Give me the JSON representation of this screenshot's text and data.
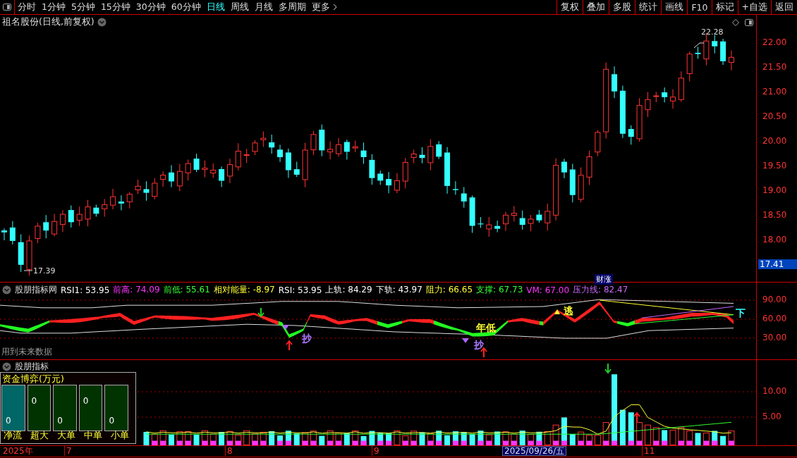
{
  "toolbar": {
    "periods": [
      {
        "label": "分时",
        "selected": false
      },
      {
        "label": "1分钟",
        "selected": false
      },
      {
        "label": "5分钟",
        "selected": false
      },
      {
        "label": "15分钟",
        "selected": false
      },
      {
        "label": "30分钟",
        "selected": false
      },
      {
        "label": "60分钟",
        "selected": false
      },
      {
        "label": "日线",
        "selected": true
      },
      {
        "label": "周线",
        "selected": false
      },
      {
        "label": "月线",
        "selected": false
      },
      {
        "label": "多周期",
        "selected": false
      }
    ],
    "more": "更多",
    "actions": [
      "复权",
      "叠加",
      "多股",
      "统计",
      "画线",
      "F10",
      "标记",
      "+自选",
      "返回"
    ]
  },
  "price_panel": {
    "title": "祖名股份(日线,前复权)",
    "y_ticks": [
      "22.00",
      "21.50",
      "21.00",
      "20.50",
      "20.00",
      "19.50",
      "19.00",
      "18.50",
      "18.00"
    ],
    "high_label": "22.28",
    "low_label": "17.39",
    "price_tag": "17.41",
    "event_tag": "财涨"
  },
  "indicator_panel": {
    "title": "股朋指标网",
    "readouts": [
      {
        "label": "RSI1:",
        "value": "53.95",
        "color": "#ffffff"
      },
      {
        "label": "前高:",
        "value": "74.09",
        "color": "#ff33ff"
      },
      {
        "label": "前低:",
        "value": "55.61",
        "color": "#33ff33"
      },
      {
        "label": "相对能量:",
        "value": "-8.97",
        "color": "#ffff33"
      },
      {
        "label": "RSI:",
        "value": "53.95",
        "color": "#ffffff"
      },
      {
        "label": "上轨:",
        "value": "84.29",
        "color": "#ffffff"
      },
      {
        "label": "下轨:",
        "value": "43.97",
        "color": "#ffffff"
      },
      {
        "label": "阻力:",
        "value": "66.65",
        "color": "#ffff33"
      },
      {
        "label": "支撑:",
        "value": "67.73",
        "color": "#33ff33"
      },
      {
        "label": "VM:",
        "value": "67.00",
        "color": "#ff33ff"
      },
      {
        "label": "压力线:",
        "value": "82.47",
        "color": "#cc66ff"
      }
    ],
    "y_ticks": [
      "90.00",
      "60.00",
      "30.00"
    ],
    "note": "用到未来数据",
    "signals": [
      {
        "text": "抄",
        "color": "#aa77ff"
      },
      {
        "text": "年低",
        "color": "#ffff33"
      },
      {
        "text": "抄",
        "color": "#aa77ff"
      },
      {
        "text": "逃",
        "color": "#ffff33"
      },
      {
        "text": "下",
        "color": "#33ffff"
      }
    ]
  },
  "volume_panel": {
    "title": "股朋指标",
    "y_ticks": [
      "10.00",
      "5.00"
    ],
    "fund_box": {
      "title": "资金博弈(万元)",
      "columns": [
        {
          "label": "净流",
          "value": "0",
          "color": "#006666"
        },
        {
          "label": "超大",
          "value": "0",
          "color": "#003300"
        },
        {
          "label": "大单",
          "value": "0",
          "color": "#003300"
        },
        {
          "label": "中单",
          "value": "0",
          "color": "#003300"
        },
        {
          "label": "小单",
          "value": "0",
          "color": "#003300"
        }
      ]
    }
  },
  "date_axis": {
    "labels": [
      "2025年",
      "7",
      "8",
      "9",
      "11"
    ],
    "cursor_date": "2025/09/26/五"
  }
}
